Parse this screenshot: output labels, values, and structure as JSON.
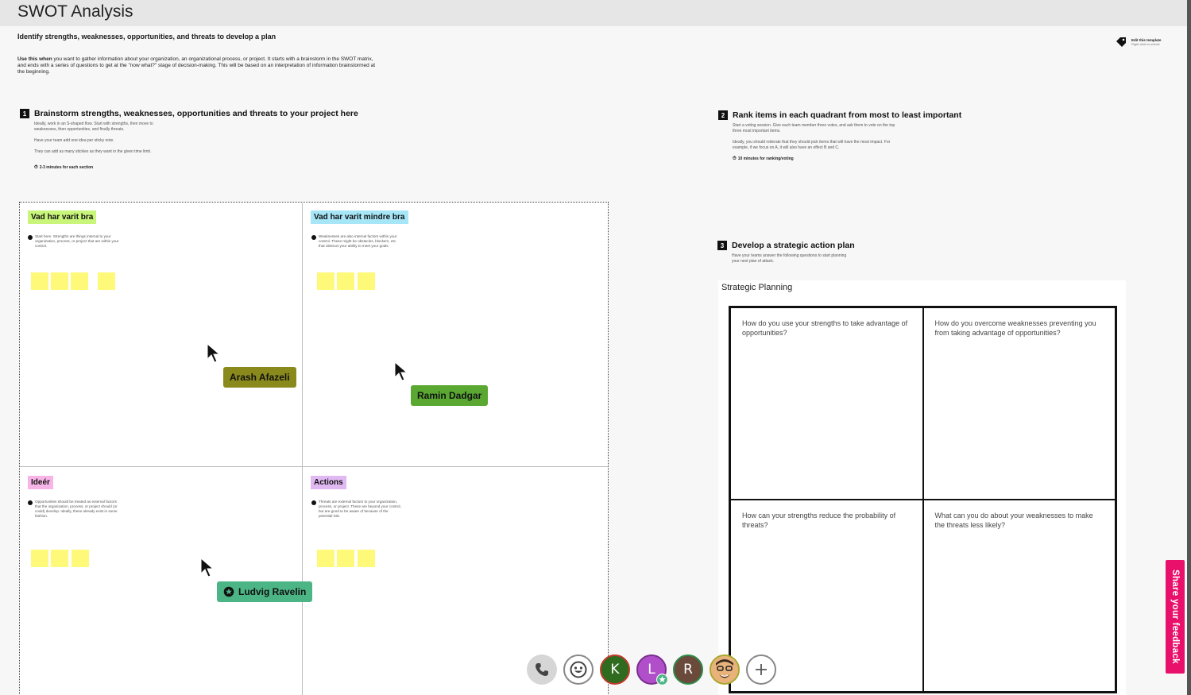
{
  "board": {
    "title": "SWOT Analysis",
    "subtitle": "Identify strengths, weaknesses, opportunities, and threats to develop a plan",
    "intro_bold": "Use this when",
    "intro_rest": " you want to gather information about your organization, an organizational process, or project. It starts with a brainstorm in the SWOT matrix, and ends with a series of questions to get at the \"now what?\" stage of decision-making. This will be based on an interpretation of information brainstormed at the beginning."
  },
  "edit_template": {
    "label": "Edit this template",
    "sub": "Right-click to unlock"
  },
  "step1": {
    "number": "1",
    "title": "Brainstorm strengths, weaknesses, opportunities and threats to your project here",
    "line1": "Ideally, work in an S-shaped flow. Start with strengths, then move to weaknesses, then opportunities, and finally threats.",
    "line2": "Have your team add one idea per sticky note.",
    "line3": "They can add as many stickies as they want in the given time limit.",
    "time": "2-3 minutes for each section"
  },
  "step2": {
    "number": "2",
    "title": "Rank items in each quadrant from most to least important",
    "line1": "Start a voting session. Give each team member three votes, and ask them to vote on the top three most important items.",
    "line2": "Ideally, you should reiterate that they should pick items that will have the most impact. For example, if we focus on A, it will also have an effect B and C.",
    "time": "10 minutes for ranking/voting"
  },
  "step3": {
    "number": "3",
    "title": "Develop a strategic action plan",
    "line1": "Have your teams answer the following questions to start planning your next plan of attack."
  },
  "quadrants": [
    {
      "label": "Vad har varit bra",
      "color": "#c8f57a",
      "desc": "Start here. Strengths are things internal to your organization, process, or project that are within your control."
    },
    {
      "label": "Vad har varit mindre bra",
      "color": "#a6e6f7",
      "desc": "Weaknesses are also internal factors within your control. These might be obstacles, blockers, etc. that obstruct your ability to meet your goals."
    },
    {
      "label": "Ideér",
      "color": "#f7b4e6",
      "desc": "Opportunities should be treated as external factors that the organization, process, or project should (or could) develop. Ideally, these already exist in some fashion."
    },
    {
      "label": "Actions",
      "color": "#e0b9f2",
      "desc": "Threats are external factors to your organization, process, or project. These are beyond your control, but are good to be aware of because of the potential risk."
    }
  ],
  "collaborators": [
    {
      "name": "Arash Afazeli",
      "color": "#8a8a1c"
    },
    {
      "name": "Ramin Dadgar",
      "color": "#5aa832"
    },
    {
      "name": "Ludvig Ravelin",
      "color": "#4cb585"
    }
  ],
  "planning": {
    "title": "Strategic Planning",
    "questions": [
      "How do you use your strengths to take advantage of opportunities?",
      "How do you overcome weaknesses preventing you from taking advantage of opportunities?",
      "How can your strengths reduce the probability of threats?",
      "What can you do about your weaknesses to make the threats less likely?"
    ]
  },
  "toolbar": {
    "avatars": [
      {
        "initial": "K",
        "color": "#2e6b1e"
      },
      {
        "initial": "L",
        "color": "#b04fc9"
      },
      {
        "initial": "R",
        "color": "#6a4a3a"
      }
    ]
  },
  "feedback": {
    "label": "Share your feedback"
  }
}
